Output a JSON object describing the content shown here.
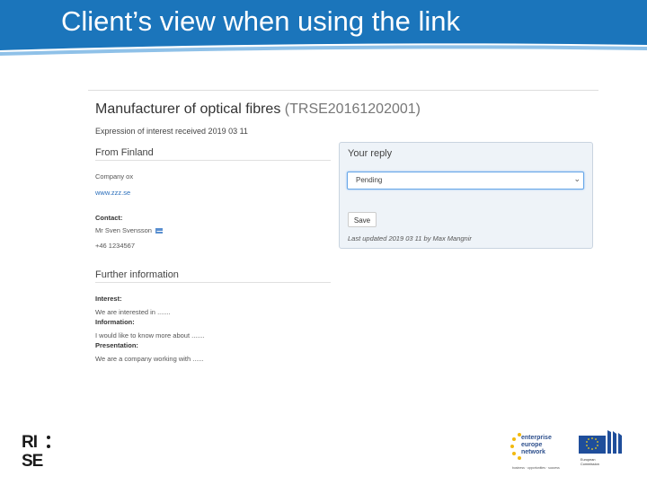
{
  "slide": {
    "title": "Client’s view when using the link"
  },
  "record": {
    "title": "Manufacturer of optical fibres",
    "code": "(TRSE20161202001)",
    "expression_received": "Expression of interest received 2019 03 11"
  },
  "from": {
    "section_title": "From Finland",
    "company": "Company ox",
    "website": "www.zzz.se",
    "contact_label": "Contact:",
    "contact_name": "Mr Sven Svensson",
    "phone": "+46 1234567"
  },
  "further": {
    "section_title": "Further information",
    "interest_label": "Interest:",
    "interest_text": "We are interested in .......",
    "information_label": "Information:",
    "information_text": "I would like to know more about .......",
    "presentation_label": "Presentation:",
    "presentation_text": "We are a company working with ......"
  },
  "reply": {
    "title": "Your reply",
    "selected": "Pending",
    "save_label": "Save",
    "last_updated": "Last updated 2019 03 11 by Max Mangnir"
  },
  "logos": {
    "rise_line1": "RI",
    "rise_line2": "SE",
    "een_line1": "enterprise",
    "een_line2": "europe",
    "een_line3": "network",
    "een_tagline": "business · opportunities · success",
    "ec_line1": "European",
    "ec_line2": "Commission"
  },
  "colors": {
    "header_blue": "#1b75bb",
    "link_blue": "#2a6ebb",
    "panel_bg": "#eef3f8"
  }
}
